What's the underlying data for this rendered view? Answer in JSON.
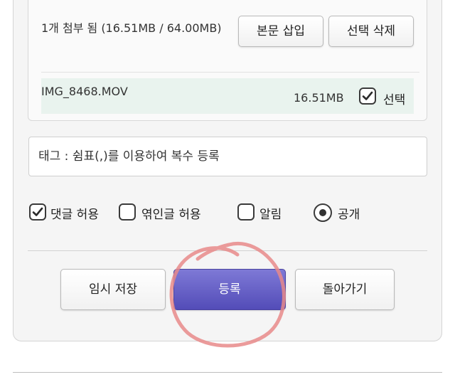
{
  "attachment": {
    "summary": "1개 첨부 됨 (16.51MB / 64.00MB)",
    "insert_button": "본문 삽입",
    "delete_button": "선택 삭제",
    "file": {
      "name": "IMG_8468.MOV",
      "size": "16.51MB",
      "select_label": "선택",
      "selected": true
    }
  },
  "tag": {
    "placeholder": "태그 : 쉼표(,)를 이용하여 복수 등록"
  },
  "options": {
    "allow_comments": {
      "label": "댓글 허용",
      "checked": true
    },
    "allow_trackback": {
      "label": "엮인글 허용",
      "checked": false
    },
    "notify": {
      "label": "알림",
      "checked": false
    },
    "public": {
      "label": "공개",
      "selected": true
    }
  },
  "actions": {
    "temp_save": "임시 저장",
    "submit": "등록",
    "back": "돌아가기"
  },
  "colors": {
    "submit_button": "#5f58c4",
    "file_row_bg": "#e9f3ee",
    "annotation_circle": "#e88a8a"
  },
  "icons": {
    "check": "check-icon",
    "radio": "radio-dot-icon"
  }
}
